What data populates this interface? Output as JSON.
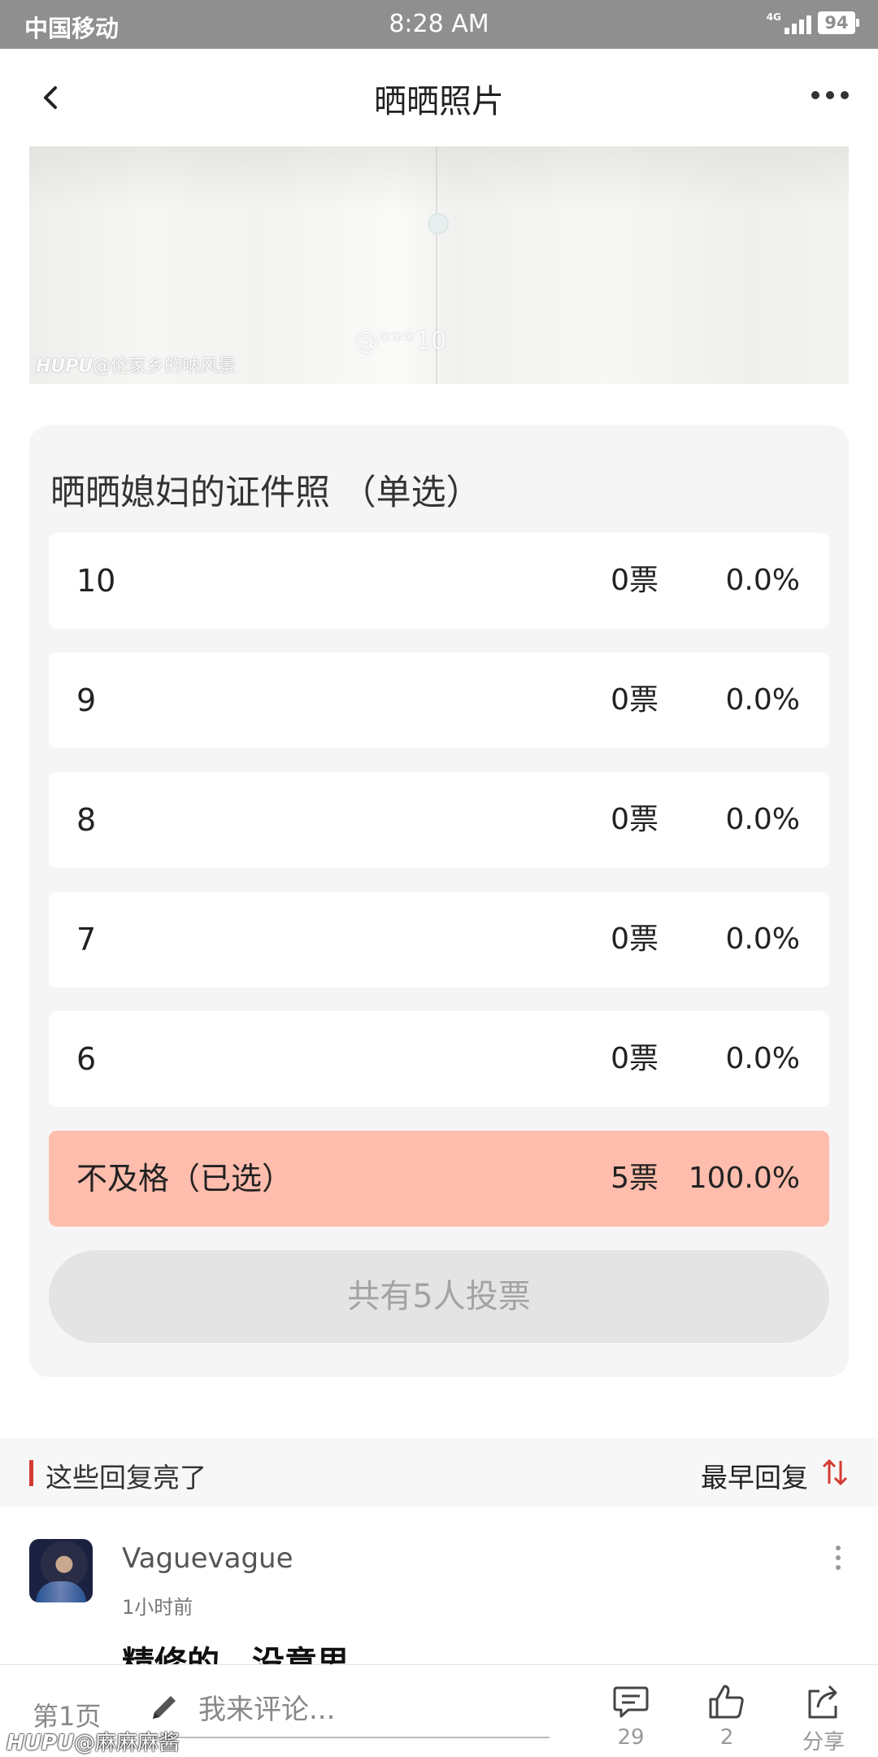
{
  "status_bar": {
    "carrier": "中国移动",
    "time": "8:28 AM",
    "network": "4G",
    "battery": "94"
  },
  "header": {
    "title": "晒晒照片",
    "back_icon": "chevron-left-icon",
    "more_icon": "more-horizontal-icon"
  },
  "photo": {
    "watermark_brand": "HUPU",
    "watermark_user": "@伦家乡的呐风景",
    "watermark_weibo": "@***10"
  },
  "poll": {
    "title": "晒晒媳妇的证件照 （单选）",
    "options": [
      {
        "label": "10",
        "votes": "0票",
        "percent": "0.0%"
      },
      {
        "label": "9",
        "votes": "0票",
        "percent": "0.0%"
      },
      {
        "label": "8",
        "votes": "0票",
        "percent": "0.0%"
      },
      {
        "label": "7",
        "votes": "0票",
        "percent": "0.0%"
      },
      {
        "label": "6",
        "votes": "0票",
        "percent": "0.0%"
      },
      {
        "label": "不及格（已选）",
        "votes": "5票",
        "percent": "100.0%"
      }
    ],
    "total": "共有5人投票",
    "selected_color": "#ffbdad"
  },
  "replies": {
    "section_title": "这些回复亮了",
    "sort_label": "最早回复",
    "accent_color": "#d43b32"
  },
  "comment": {
    "username": "Vaguevague",
    "time": "1小时前",
    "text": "精修的，没意思"
  },
  "bottom_bar": {
    "page": "第1页",
    "input_placeholder": "我来评论...",
    "comments_count": "29",
    "likes_count": "2",
    "share_label": "分享",
    "watermark_brand": "HUPU",
    "watermark_user": "@麻麻麻酱"
  }
}
